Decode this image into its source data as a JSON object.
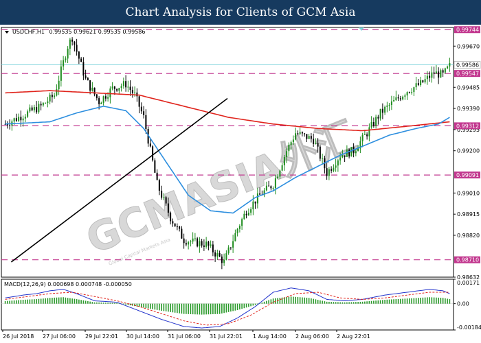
{
  "header": {
    "title": "Chart Analysis for Clients of GCM Asia"
  },
  "watermark": {
    "text": "GCMASIA外汇",
    "sub": "Global Capital Markets Asia"
  },
  "colors": {
    "background": "#ffffff",
    "banner": "#163a5f",
    "bull_candle": "#1e8c1e",
    "bear_candle": "#000000",
    "level_line": "#c2388f",
    "current_price": "#7fd3db",
    "ma_fast": "#2e8fdf",
    "ma_slow": "#e0241c",
    "trendline": "#000000",
    "macd_hist": "#2a9a2a",
    "macd_signal": "#e0241c",
    "macd_line": "#2233cc"
  },
  "chart_data": [
    {
      "type": "candlestick",
      "symbol": "USDCHF,H1",
      "ohlc_text": "0.99535 0.99621 0.99535 0.99586",
      "ylim": [
        0.98632,
        0.99754
      ],
      "y_ticks": [
        "0.99670",
        "0.99485",
        "0.99390",
        "0.99295",
        "0.99200",
        "0.99010",
        "0.98915",
        "0.98820",
        "0.98632"
      ],
      "x_tick_labels": [
        "26 Jul 2018",
        "27 Jul 06:00",
        "29 Jul 22:01",
        "30 Jul 14:00",
        "31 Jul 06:00",
        "31 Jul 22:01",
        "1 Aug 14:00",
        "2 Aug 06:00",
        "2 Aug 22:01"
      ],
      "price_levels": [
        {
          "value": 0.99744,
          "label": "0.99744"
        },
        {
          "value": 0.99547,
          "label": "0.99547"
        },
        {
          "value": 0.99312,
          "label": "0.99312"
        },
        {
          "value": 0.99091,
          "label": "0.99091"
        },
        {
          "value": 0.9871,
          "label": "0.98710"
        }
      ],
      "current_price": {
        "value": 0.99586,
        "label": "0.99586"
      },
      "trendline": {
        "from": [
          0.984,
          0.987
        ],
        "to": [
          0.5,
          0.99435
        ]
      },
      "n_bars": 200,
      "close_keypoints": [
        [
          0,
          0.9932
        ],
        [
          8,
          0.9936
        ],
        [
          16,
          0.994
        ],
        [
          22,
          0.9945
        ],
        [
          28,
          0.9967
        ],
        [
          30,
          0.9971
        ],
        [
          36,
          0.9952
        ],
        [
          42,
          0.9942
        ],
        [
          48,
          0.9948
        ],
        [
          54,
          0.995
        ],
        [
          58,
          0.9945
        ],
        [
          62,
          0.9935
        ],
        [
          68,
          0.9905
        ],
        [
          74,
          0.989
        ],
        [
          80,
          0.988
        ],
        [
          84,
          0.9879
        ],
        [
          90,
          0.9878
        ],
        [
          94,
          0.9874
        ],
        [
          98,
          0.987
        ],
        [
          104,
          0.9885
        ],
        [
          108,
          0.9893
        ],
        [
          114,
          0.99
        ],
        [
          120,
          0.9905
        ],
        [
          126,
          0.992
        ],
        [
          130,
          0.9928
        ],
        [
          138,
          0.9925
        ],
        [
          144,
          0.991
        ],
        [
          150,
          0.9918
        ],
        [
          156,
          0.992
        ],
        [
          162,
          0.9928
        ],
        [
          168,
          0.9937
        ],
        [
          174,
          0.9942
        ],
        [
          180,
          0.9947
        ],
        [
          186,
          0.995
        ],
        [
          192,
          0.9955
        ],
        [
          196,
          0.9954
        ],
        [
          199,
          0.9958
        ]
      ],
      "ma_fast_keypoints": [
        [
          0,
          0.9932
        ],
        [
          20,
          0.9933
        ],
        [
          32,
          0.9937
        ],
        [
          44,
          0.994
        ],
        [
          54,
          0.9938
        ],
        [
          62,
          0.993
        ],
        [
          72,
          0.9915
        ],
        [
          82,
          0.99
        ],
        [
          92,
          0.9893
        ],
        [
          102,
          0.9892
        ],
        [
          112,
          0.9899
        ],
        [
          120,
          0.9902
        ],
        [
          130,
          0.9908
        ],
        [
          140,
          0.9913
        ],
        [
          150,
          0.9918
        ],
        [
          160,
          0.9922
        ],
        [
          172,
          0.9927
        ],
        [
          184,
          0.993
        ],
        [
          194,
          0.9932
        ],
        [
          199,
          0.9935
        ]
      ],
      "ma_slow_keypoints": [
        [
          0,
          0.9946
        ],
        [
          20,
          0.9947
        ],
        [
          40,
          0.9946
        ],
        [
          60,
          0.9945
        ],
        [
          80,
          0.994
        ],
        [
          100,
          0.9935
        ],
        [
          120,
          0.9932
        ],
        [
          140,
          0.993
        ],
        [
          160,
          0.9929
        ],
        [
          180,
          0.9931
        ],
        [
          199,
          0.9933
        ]
      ],
      "series": [
        {
          "name": "",
          "kind": "ma_fast"
        },
        {
          "name": "",
          "kind": "ma_slow"
        }
      ]
    },
    {
      "type": "macd",
      "label": "MACD(12,26,9) 0.000698 0.000748 -0.000050",
      "ylim": [
        -0.00184,
        0.00171
      ],
      "y_ticks": [
        "0.00171",
        "0.00",
        "-0.00184"
      ],
      "macd_keypoints": [
        [
          0,
          0.0004
        ],
        [
          8,
          0.0006
        ],
        [
          14,
          0.0007
        ],
        [
          20,
          0.0009
        ],
        [
          26,
          0.001
        ],
        [
          32,
          0.0007
        ],
        [
          40,
          0.0002
        ],
        [
          50,
          0.0001
        ],
        [
          60,
          -0.0005
        ],
        [
          70,
          -0.0011
        ],
        [
          80,
          -0.0016
        ],
        [
          88,
          -0.0017
        ],
        [
          96,
          -0.0016
        ],
        [
          104,
          -0.001
        ],
        [
          112,
          -0.0002
        ],
        [
          120,
          0.0008
        ],
        [
          128,
          0.0011
        ],
        [
          136,
          0.0009
        ],
        [
          144,
          0.0003
        ],
        [
          152,
          0.0002
        ],
        [
          160,
          0.0003
        ],
        [
          170,
          0.0006
        ],
        [
          180,
          0.0008
        ],
        [
          190,
          0.001
        ],
        [
          196,
          0.0009
        ],
        [
          199,
          0.0007
        ]
      ],
      "signal_keypoints": [
        [
          0,
          0.0003
        ],
        [
          10,
          0.0005
        ],
        [
          20,
          0.0007
        ],
        [
          30,
          0.0008
        ],
        [
          40,
          0.0005
        ],
        [
          50,
          0.0002
        ],
        [
          60,
          -0.0002
        ],
        [
          70,
          -0.0007
        ],
        [
          80,
          -0.0012
        ],
        [
          90,
          -0.0015
        ],
        [
          100,
          -0.0014
        ],
        [
          110,
          -0.0008
        ],
        [
          120,
          0.0001
        ],
        [
          130,
          0.0007
        ],
        [
          140,
          0.0008
        ],
        [
          150,
          0.0004
        ],
        [
          160,
          0.0003
        ],
        [
          170,
          0.0004
        ],
        [
          180,
          0.0006
        ],
        [
          190,
          0.0008
        ],
        [
          199,
          0.0008
        ]
      ]
    }
  ]
}
